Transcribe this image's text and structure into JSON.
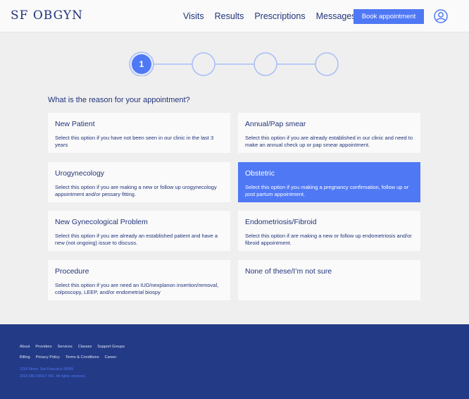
{
  "header": {
    "logo": "SF OBGYN",
    "nav": [
      "Visits",
      "Results",
      "Prescriptions",
      "Messages"
    ],
    "book_label": "Book appointment"
  },
  "stepper": {
    "current_step": 1,
    "total_steps": 4
  },
  "question": "What is the reason for your appointment?",
  "options": [
    {
      "title": "New Patient",
      "desc": "Select this option if you have not been seen in our clinic in the last 3 years"
    },
    {
      "title": "Annual/Pap smear",
      "desc": "Select this option if you are already established in our clinic and need to make an annual check up or pap smear appointment."
    },
    {
      "title": "Urogynecology",
      "desc": "Select this option if you are making a new or follow up urogynecology appointment and/or pessary fitting."
    },
    {
      "title": "Obstetric",
      "desc": "Select this option if you making a pregnancy confirmation, follow up or post partum appointment."
    },
    {
      "title": "New Gynecological Problem",
      "desc": "Select this option if you are already an established patient and have a new (not ongoing) issue to discuss."
    },
    {
      "title": "Endometriosis/Fibroid",
      "desc": "Select this option if are making a new or follow up endometriosis and/or fibroid appointment."
    },
    {
      "title": "Procedure",
      "desc": "Select this option if you are need an IUD/nexplanon insertion/removal, colposcopy, LEEP, and/or endometrial biospy"
    },
    {
      "title": "None of these/I’m not sure",
      "desc": ""
    }
  ],
  "selected_option": "Obstetric",
  "footer": {
    "links_row1": [
      "About",
      "Providers",
      "Services",
      "Classes",
      "Support Groups"
    ],
    "links_row2": [
      "Billing",
      "Privacy Policy",
      "Terms & Conditions",
      "Career"
    ],
    "address": "1234 Street, San Francisco 99999",
    "copyright": "2019 SBL/OB/GY INC. All rights reserved."
  },
  "colors": {
    "brand_navy": "#22337a",
    "accent_blue": "#4f78f5",
    "footer_bg": "#233a86",
    "page_bg": "#efefef",
    "step_inactive": "#a9bdf7"
  },
  "icons": {
    "account": "user-circle-icon"
  }
}
